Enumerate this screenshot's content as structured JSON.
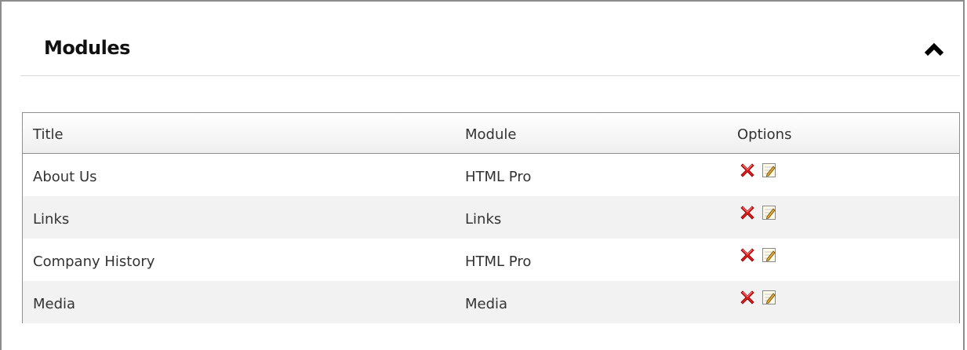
{
  "panel": {
    "title": "Modules",
    "collapse_icon": "chevron-up-icon"
  },
  "table": {
    "columns": [
      "Title",
      "Module",
      "Options"
    ],
    "rows": [
      {
        "title": "About Us",
        "module": "HTML Pro",
        "options": [
          "delete-icon",
          "edit-icon"
        ]
      },
      {
        "title": "Links",
        "module": "Links",
        "options": [
          "delete-icon",
          "edit-icon"
        ]
      },
      {
        "title": "Company History",
        "module": "HTML Pro",
        "options": [
          "delete-icon",
          "edit-icon"
        ]
      },
      {
        "title": "Media",
        "module": "Media",
        "options": [
          "delete-icon",
          "edit-icon"
        ]
      }
    ]
  },
  "colors": {
    "delete_icon": "#e01b1b",
    "alt_row": "#f2f2f2",
    "border": "#8f8f8f"
  }
}
